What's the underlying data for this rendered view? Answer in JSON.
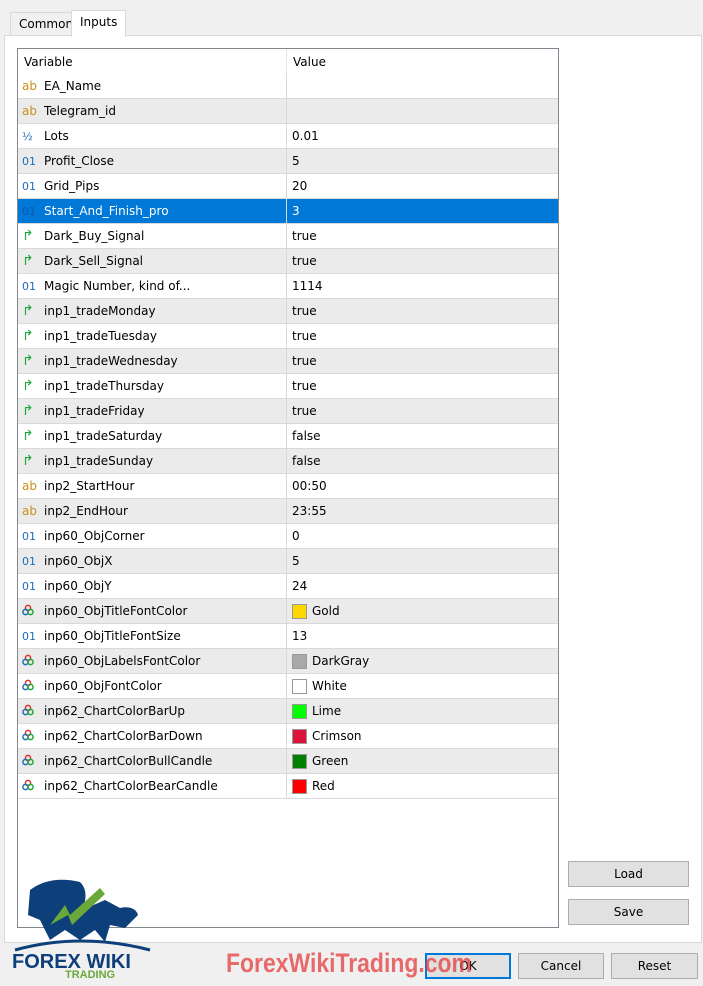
{
  "tabs": [
    {
      "label": "Common"
    },
    {
      "label": "Inputs"
    }
  ],
  "grid": {
    "header": {
      "variable": "Variable",
      "value": "Value"
    },
    "rows": [
      {
        "type": "ab",
        "name": "EA_Name",
        "value": ""
      },
      {
        "type": "ab",
        "name": "Telegram_id",
        "value": ""
      },
      {
        "type": "dbl",
        "name": "Lots",
        "value": "0.01"
      },
      {
        "type": "int",
        "name": "Profit_Close",
        "value": "5"
      },
      {
        "type": "int",
        "name": "Grid_Pips",
        "value": "20"
      },
      {
        "type": "int",
        "name": "Start_And_Finish_pro",
        "value": "3",
        "selected": true
      },
      {
        "type": "bool",
        "name": "Dark_Buy_Signal",
        "value": "true"
      },
      {
        "type": "bool",
        "name": "Dark_Sell_Signal",
        "value": "true"
      },
      {
        "type": "int",
        "name": "Magic Number, kind of...",
        "value": "1114"
      },
      {
        "type": "bool",
        "name": "inp1_tradeMonday",
        "value": "true"
      },
      {
        "type": "bool",
        "name": "inp1_tradeTuesday",
        "value": "true"
      },
      {
        "type": "bool",
        "name": "inp1_tradeWednesday",
        "value": "true"
      },
      {
        "type": "bool",
        "name": "inp1_tradeThursday",
        "value": "true"
      },
      {
        "type": "bool",
        "name": "inp1_tradeFriday",
        "value": "true"
      },
      {
        "type": "bool",
        "name": "inp1_tradeSaturday",
        "value": "false"
      },
      {
        "type": "bool",
        "name": "inp1_tradeSunday",
        "value": "false"
      },
      {
        "type": "ab",
        "name": "inp2_StartHour",
        "value": "00:50"
      },
      {
        "type": "ab",
        "name": "inp2_EndHour",
        "value": "23:55"
      },
      {
        "type": "int",
        "name": "inp60_ObjCorner",
        "value": "0"
      },
      {
        "type": "int",
        "name": "inp60_ObjX",
        "value": "5"
      },
      {
        "type": "int",
        "name": "inp60_ObjY",
        "value": "24"
      },
      {
        "type": "color",
        "name": "inp60_ObjTitleFontColor",
        "value": "Gold",
        "color": "#ffd700"
      },
      {
        "type": "int",
        "name": "inp60_ObjTitleFontSize",
        "value": "13"
      },
      {
        "type": "color",
        "name": "inp60_ObjLabelsFontColor",
        "value": "DarkGray",
        "color": "#a9a9a9"
      },
      {
        "type": "color",
        "name": "inp60_ObjFontColor",
        "value": "White",
        "color": "#ffffff"
      },
      {
        "type": "color",
        "name": "inp62_ChartColorBarUp",
        "value": "Lime",
        "color": "#00ff00"
      },
      {
        "type": "color",
        "name": "inp62_ChartColorBarDown",
        "value": "Crimson",
        "color": "#dc143c"
      },
      {
        "type": "color",
        "name": "inp62_ChartColorBullCandle",
        "value": "Green",
        "color": "#008000"
      },
      {
        "type": "color",
        "name": "inp62_ChartColorBearCandle",
        "value": "Red",
        "color": "#ff0000"
      }
    ]
  },
  "buttons": {
    "load": "Load",
    "save": "Save",
    "ok": "OK",
    "cancel": "Cancel",
    "reset": "Reset"
  },
  "watermark": "ForexWikiTrading.com",
  "logo": {
    "line1": "FOREX WIKI",
    "line2": "TRADING"
  },
  "colors": {
    "selected": "#0078d7"
  }
}
